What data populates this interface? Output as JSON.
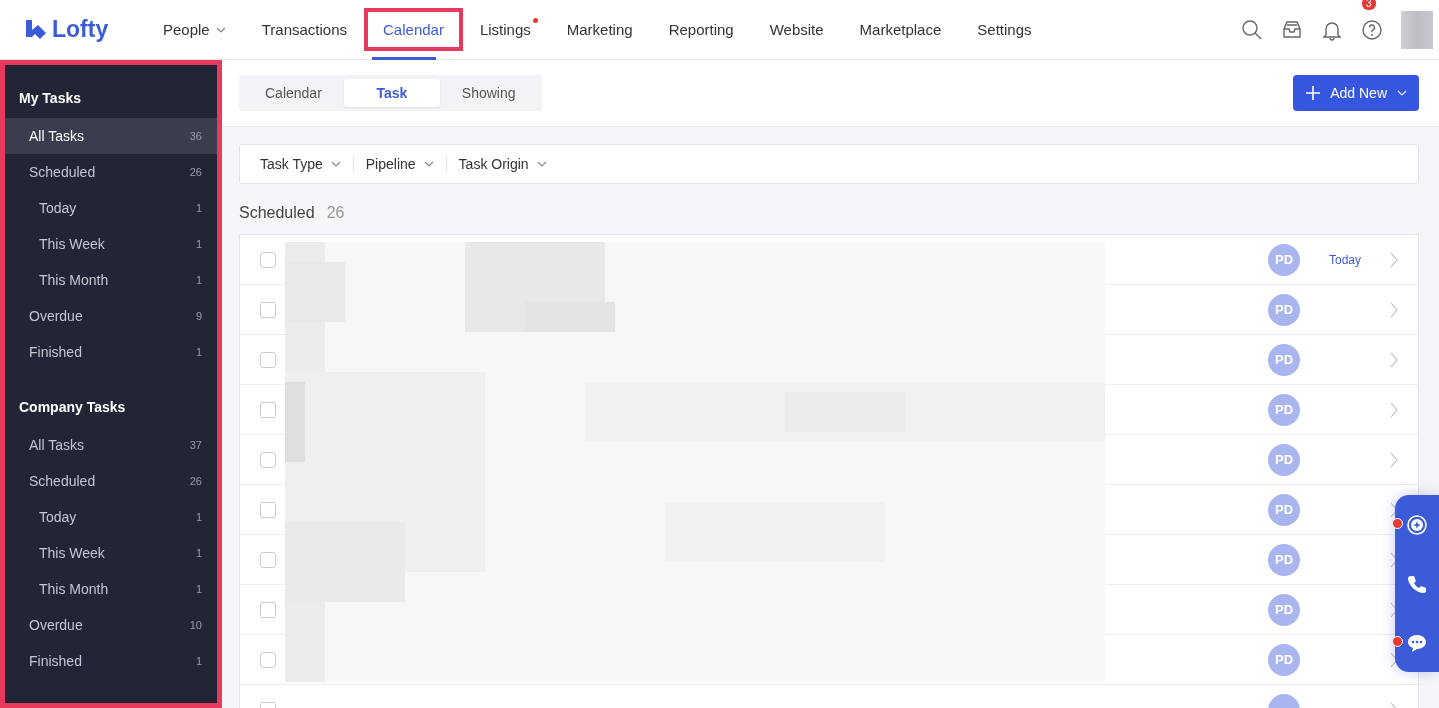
{
  "logo": "Lofty",
  "nav": [
    {
      "label": "People",
      "dropdown": true,
      "selected": false,
      "highlighted": false,
      "dot": false
    },
    {
      "label": "Transactions",
      "dropdown": false,
      "selected": false,
      "highlighted": false,
      "dot": false
    },
    {
      "label": "Calendar",
      "dropdown": false,
      "selected": true,
      "highlighted": true,
      "dot": false
    },
    {
      "label": "Listings",
      "dropdown": false,
      "selected": false,
      "highlighted": false,
      "dot": true
    },
    {
      "label": "Marketing",
      "dropdown": false,
      "selected": false,
      "highlighted": false,
      "dot": false
    },
    {
      "label": "Reporting",
      "dropdown": false,
      "selected": false,
      "highlighted": false,
      "dot": false
    },
    {
      "label": "Website",
      "dropdown": false,
      "selected": false,
      "highlighted": false,
      "dot": false
    },
    {
      "label": "Marketplace",
      "dropdown": false,
      "selected": false,
      "highlighted": false,
      "dot": false
    },
    {
      "label": "Settings",
      "dropdown": false,
      "selected": false,
      "highlighted": false,
      "dot": false
    }
  ],
  "notifications_badge": "3",
  "sidebar": {
    "highlighted": true,
    "groups": [
      {
        "title": "My Tasks",
        "items": [
          {
            "label": "All Tasks",
            "count": "36",
            "selected": true
          },
          {
            "label": "Scheduled",
            "count": "26",
            "selected": false,
            "children": [
              {
                "label": "Today",
                "count": "1",
                "selected": false
              },
              {
                "label": "This Week",
                "count": "1",
                "selected": false
              },
              {
                "label": "This Month",
                "count": "1",
                "selected": false
              }
            ]
          },
          {
            "label": "Overdue",
            "count": "9",
            "selected": false
          },
          {
            "label": "Finished",
            "count": "1",
            "selected": false
          }
        ]
      },
      {
        "title": "Company Tasks",
        "items": [
          {
            "label": "All Tasks",
            "count": "37",
            "selected": false
          },
          {
            "label": "Scheduled",
            "count": "26",
            "selected": false,
            "children": [
              {
                "label": "Today",
                "count": "1",
                "selected": false
              },
              {
                "label": "This Week",
                "count": "1",
                "selected": false
              },
              {
                "label": "This Month",
                "count": "1",
                "selected": false
              }
            ]
          },
          {
            "label": "Overdue",
            "count": "10",
            "selected": false
          },
          {
            "label": "Finished",
            "count": "1",
            "selected": false
          }
        ]
      }
    ]
  },
  "view_tabs": [
    {
      "label": "Calendar",
      "selected": false
    },
    {
      "label": "Task",
      "selected": true
    },
    {
      "label": "Showing",
      "selected": false
    }
  ],
  "add_button": "Add New",
  "filters": [
    "Task Type",
    "Pipeline",
    "Task Origin"
  ],
  "section": {
    "title": "Scheduled",
    "count": "26"
  },
  "tasks": [
    {
      "assignee": "PD",
      "due": "Today",
      "checked": false
    },
    {
      "assignee": "PD",
      "checked": false
    },
    {
      "assignee": "PD",
      "checked": false
    },
    {
      "assignee": "PD",
      "checked": false
    },
    {
      "assignee": "PD",
      "checked": false
    },
    {
      "assignee": "PD",
      "checked": false
    },
    {
      "assignee": "PD",
      "checked": false
    },
    {
      "assignee": "PD",
      "checked": false
    },
    {
      "assignee": "PD",
      "checked": false
    },
    {
      "checked": false
    }
  ]
}
